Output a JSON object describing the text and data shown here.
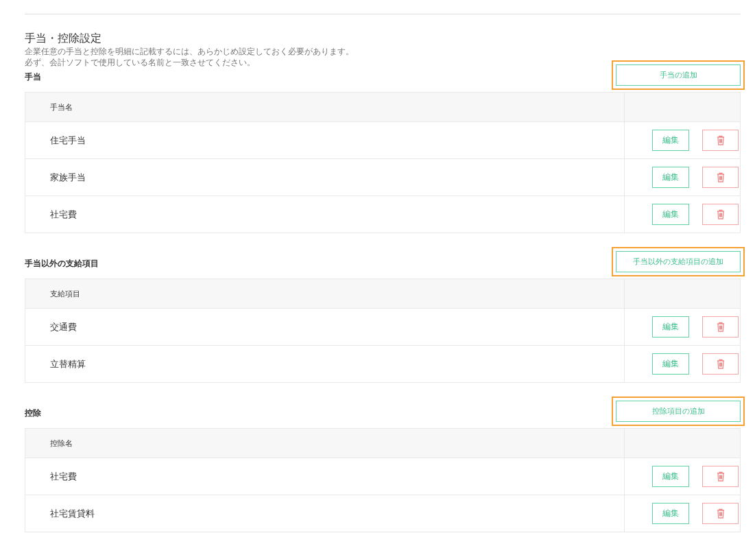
{
  "title": "手当・控除設定",
  "description": [
    "企業任意の手当と控除を明細に記載するには、あらかじめ設定しておく必要があります。",
    "必ず、会計ソフトで使用している名前と一致させてください。"
  ],
  "sections": [
    {
      "heading": "手当",
      "add_button": {
        "label": "手当の追加",
        "highlighted": true
      },
      "column": "手当名",
      "rows": [
        {
          "name": "住宅手当",
          "edit_button": "編集"
        },
        {
          "name": "家族手当",
          "edit_button": "編集"
        },
        {
          "name": "社宅費",
          "edit_button": "編集"
        }
      ]
    },
    {
      "heading": "手当以外の支給項目",
      "add_button": {
        "label": "手当以外の支給項目の追加",
        "highlighted": true
      },
      "column": "支給項目",
      "rows": [
        {
          "name": "交通費",
          "edit_button": "編集"
        },
        {
          "name": "立替精算",
          "edit_button": "編集"
        }
      ]
    },
    {
      "heading": "控除",
      "add_button": {
        "label": "控除項目の追加",
        "highlighted": true
      },
      "column": "控除名",
      "rows": [
        {
          "name": "社宅費",
          "edit_button": "編集"
        },
        {
          "name": "社宅賃貸料",
          "edit_button": "編集"
        }
      ]
    }
  ]
}
